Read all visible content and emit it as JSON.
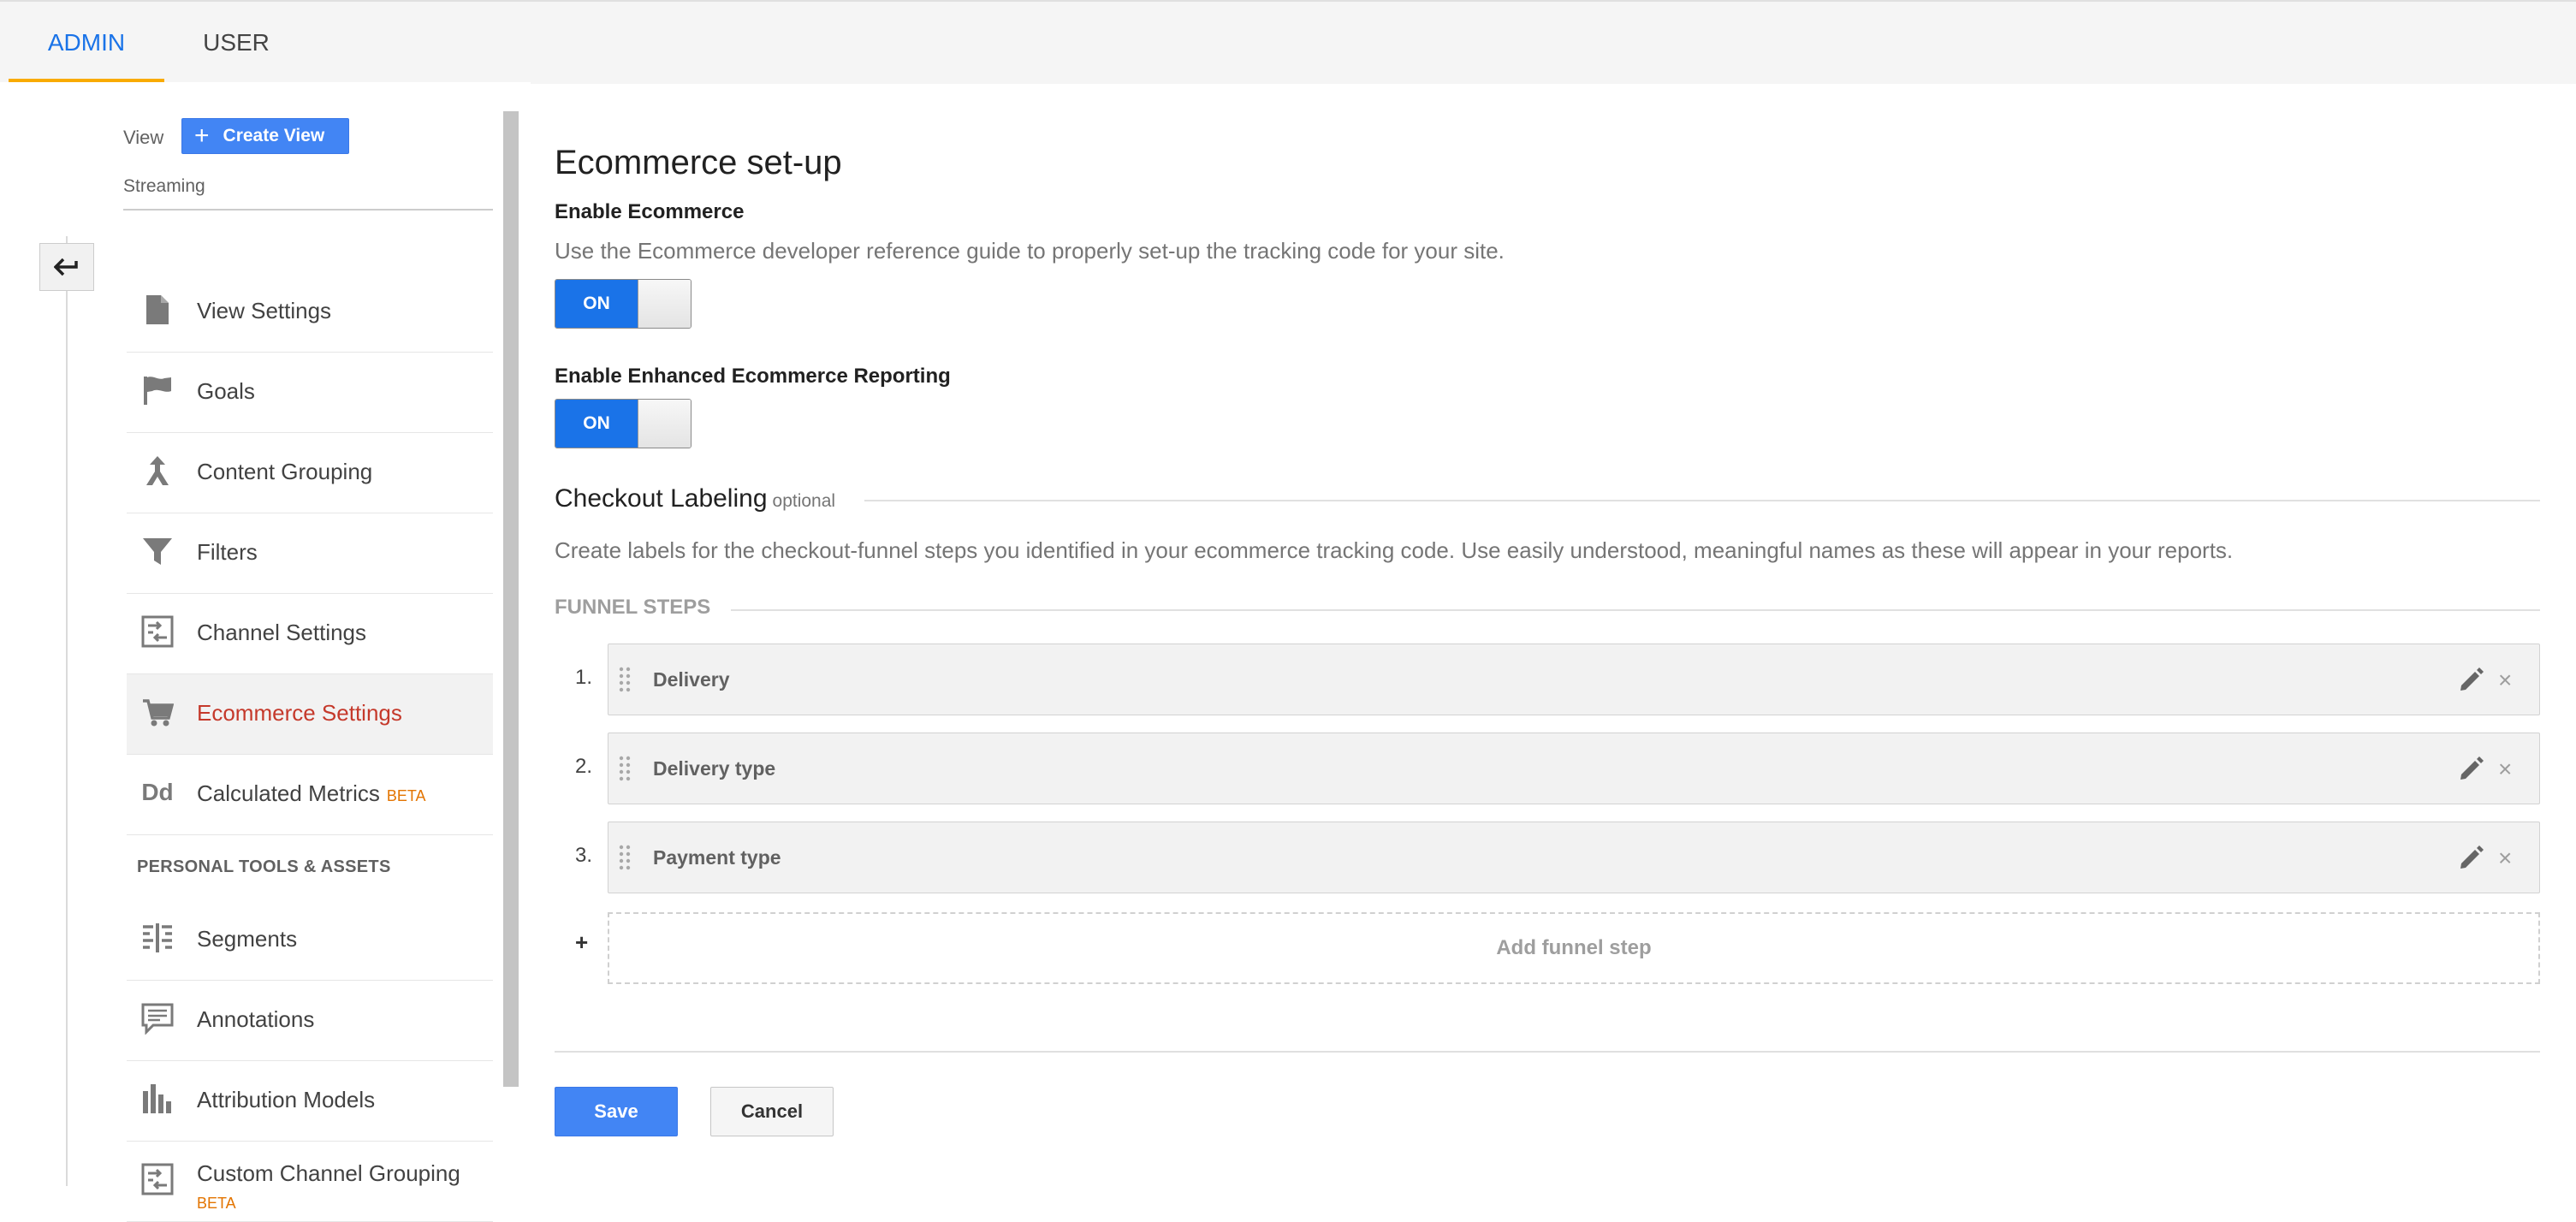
{
  "tabs": {
    "admin": "ADMIN",
    "user": "USER"
  },
  "sidebar": {
    "view_label": "View",
    "create_view_label": "Create View",
    "view_name": "Streaming",
    "items": [
      {
        "label": "View Settings",
        "icon": "document-icon"
      },
      {
        "label": "Goals",
        "icon": "flag-icon"
      },
      {
        "label": "Content Grouping",
        "icon": "merge-arrow-icon"
      },
      {
        "label": "Filters",
        "icon": "filter-icon"
      },
      {
        "label": "Channel Settings",
        "icon": "channel-icon"
      },
      {
        "label": "Ecommerce Settings",
        "icon": "cart-icon",
        "active": true
      },
      {
        "label": "Calculated Metrics",
        "badge": "BETA",
        "icon": "dd-icon"
      }
    ],
    "personal_heading": "PERSONAL TOOLS & ASSETS",
    "personal_items": [
      {
        "label": "Segments",
        "icon": "segments-icon"
      },
      {
        "label": "Annotations",
        "icon": "annotation-icon"
      },
      {
        "label": "Attribution Models",
        "icon": "bar-chart-icon"
      },
      {
        "label": "Custom Channel Grouping",
        "badge": "BETA",
        "icon": "channel-icon"
      }
    ]
  },
  "main": {
    "title": "Ecommerce set-up",
    "enable_ecommerce": {
      "title": "Enable Ecommerce",
      "description": "Use the Ecommerce developer reference guide to properly set-up the tracking code for your site.",
      "toggle": "ON"
    },
    "enhanced": {
      "title": "Enable Enhanced Ecommerce Reporting",
      "toggle": "ON"
    },
    "checkout": {
      "title": "Checkout Labeling",
      "optional": "optional",
      "description": "Create labels for the checkout-funnel steps you identified in your ecommerce tracking code. Use easily understood, meaningful names as these will appear in your reports."
    },
    "funnel_heading": "FUNNEL STEPS",
    "steps": [
      {
        "num": "1.",
        "label": "Delivery"
      },
      {
        "num": "2.",
        "label": "Delivery type"
      },
      {
        "num": "3.",
        "label": "Payment type"
      }
    ],
    "add_step_plus": "+",
    "add_step_label": "Add funnel step",
    "save_label": "Save",
    "cancel_label": "Cancel"
  },
  "colors": {
    "accent": "#4285f4",
    "toggle_on": "#1a73e8",
    "active_nav": "#c5392b",
    "beta": "#e37400",
    "tab_indicator": "#f9ab00"
  }
}
